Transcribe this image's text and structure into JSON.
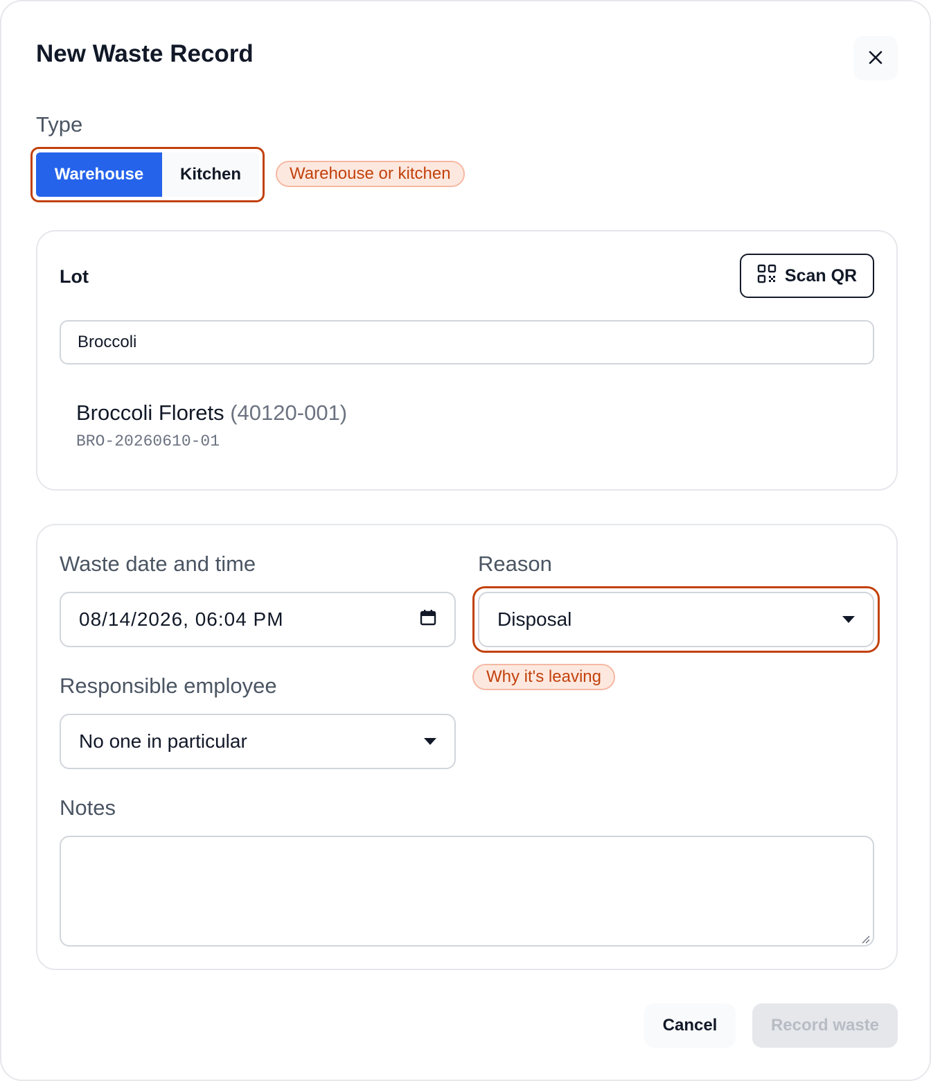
{
  "dialog": {
    "title": "New Waste Record",
    "close_icon": "close-icon"
  },
  "type": {
    "label": "Type",
    "options": [
      "Warehouse",
      "Kitchen"
    ],
    "selected": "Warehouse",
    "hint": "Warehouse or kitchen"
  },
  "lot": {
    "label": "Lot",
    "scan_label": "Scan QR",
    "scan_icon": "qr-code-icon",
    "search_value": "Broccoli",
    "result": {
      "name": "Broccoli Florets",
      "code": "(40120-001)",
      "lot_number": "BRO-20260610-01"
    }
  },
  "details": {
    "date_label": "Waste date and time",
    "date_value": "08/14/2026, 06:04 PM",
    "date_icon": "calendar-icon",
    "reason_label": "Reason",
    "reason_value": "Disposal",
    "reason_hint": "Why it's leaving",
    "employee_label": "Responsible employee",
    "employee_value": "No one in particular",
    "notes_label": "Notes",
    "notes_value": ""
  },
  "footer": {
    "cancel_label": "Cancel",
    "submit_label": "Record waste"
  },
  "colors": {
    "accent": "#2563eb",
    "highlight": "#c2410c",
    "hint_bg": "#fde8df"
  }
}
